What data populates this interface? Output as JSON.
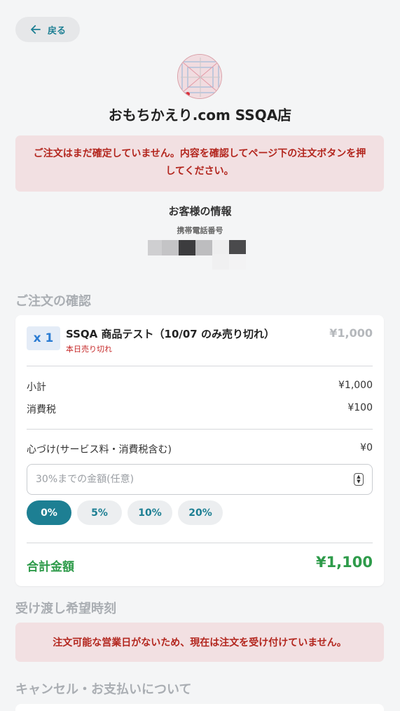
{
  "header": {
    "back_label": "戻る"
  },
  "store": {
    "name": "おもちかえり.com SSQA店"
  },
  "alerts": {
    "unconfirmed": "ご注文はまだ確定していません。内容を確認してページ下の注文ボタンを押してください。",
    "closed": "注文可能な営業日がないため、現在は注文を受け付けていません。"
  },
  "customer": {
    "title": "お客様の情報",
    "phone_label": "携帯電話番号"
  },
  "sections": {
    "order_confirm": "ご注文の確認",
    "pickup_time": "受け渡し希望時刻",
    "cancel_payment": "キャンセル・お支払いについて"
  },
  "order": {
    "quantity": "x 1",
    "item_name": "SSQA 商品テスト（10/07 のみ売り切れ）",
    "item_note": "本日売り切れ",
    "item_price": "¥1,000",
    "subtotal_label": "小計",
    "subtotal_value": "¥1,000",
    "tax_label": "消費税",
    "tax_value": "¥100",
    "tip_label": "心づけ(サービス料・消費税含む)",
    "tip_value": "¥0",
    "tip_placeholder": "30%までの金額(任意)",
    "tip_options": [
      "0%",
      "5%",
      "10%",
      "20%"
    ],
    "tip_selected": "0%",
    "total_label": "合計金額",
    "total_value": "¥1,100"
  },
  "colors": {
    "accent": "#1d7f93",
    "alert_bg": "#f2e0e2",
    "alert_text": "#b3261e",
    "total": "#2e9b4a"
  }
}
